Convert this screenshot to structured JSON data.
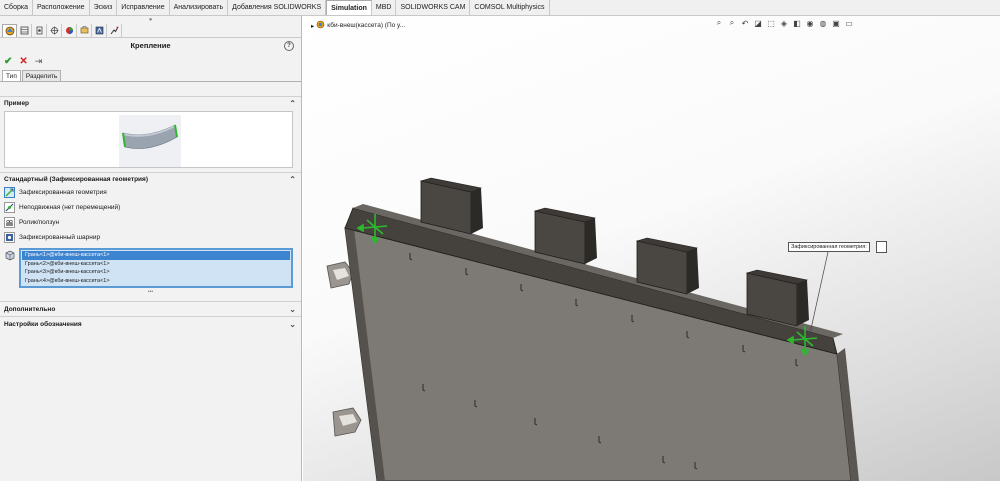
{
  "command_tabs": [
    {
      "label": "Сборка"
    },
    {
      "label": "Расположение"
    },
    {
      "label": "Эскиз"
    },
    {
      "label": "Исправление"
    },
    {
      "label": "Анализировать"
    },
    {
      "label": "Добавления SOLIDWORKS"
    },
    {
      "label": "Simulation",
      "active": true
    },
    {
      "label": "MBD"
    },
    {
      "label": "SOLIDWORKS CAM"
    },
    {
      "label": "COMSOL Multiphysics"
    }
  ],
  "property_manager": {
    "title": "Крепление",
    "help": "?",
    "sub_tabs": [
      "Тип",
      "Разделить"
    ],
    "example_header": "Пример",
    "standard_header": "Стандартный (Зафиксированная геометрия)",
    "options": [
      "Зафиксированная геометрия",
      "Неподвижная (нет перемещений)",
      "Ролик/ползун",
      "Зафиксированный шарнир"
    ],
    "selection_items": [
      "Грань<1>@кби-внеш-кассета<1>",
      "Грань<2>@кби-внеш-кассета<1>",
      "Грань<3>@кби-внеш-кассета<1>",
      "Грань<4>@кби-внеш-кассета<1>"
    ],
    "advanced_header": "Дополнительно",
    "symbol_header": "Настройки обозначения"
  },
  "viewport": {
    "tree_node": "кби-внеш(кассета) (По у...",
    "callout_label": "Зафиксированная геометрия:"
  },
  "colors": {
    "accent": "#3c83d0",
    "model_face": "#7d7a75",
    "model_dark": "#3d3a37",
    "fixture_green": "#2eb82e"
  }
}
